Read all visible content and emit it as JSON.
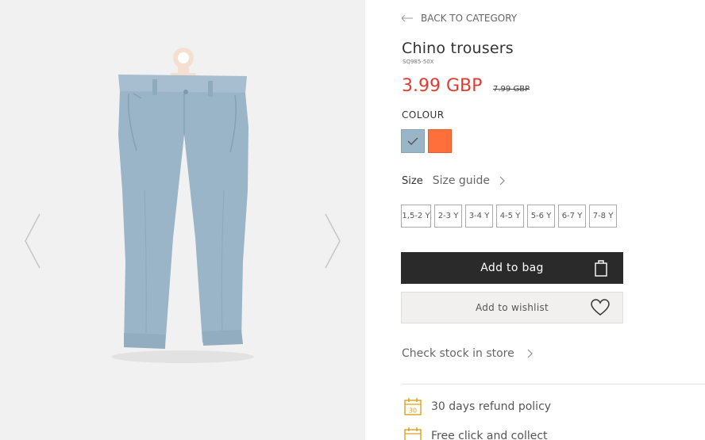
{
  "gallery": {
    "prev_icon": "chevron-left-icon",
    "next_icon": "chevron-right-icon",
    "product_colors": {
      "fabric": "#9ab4c8",
      "hanger": "#f5dfd0",
      "background": "#f1f1f1"
    }
  },
  "product": {
    "back_label": "BACK TO CATEGORY",
    "title": "Chino trousers",
    "sku": "SQ985-50X",
    "price": "3.99 GBP",
    "old_price": "7.99 GBP",
    "price_color": "#e03c31",
    "colour_label": "COLOUR",
    "colours": [
      {
        "name": "blue",
        "hex": "#9ab4c8",
        "selected": true
      },
      {
        "name": "orange",
        "hex": "#ff6f3c",
        "selected": false
      }
    ],
    "size_label": "Size",
    "size_guide_label": "Size guide",
    "sizes": [
      "1,5-2 Y",
      "2-3 Y",
      "3-4 Y",
      "4-5 Y",
      "5-6 Y",
      "6-7 Y",
      "7-8 Y"
    ],
    "add_to_bag_label": "Add to bag",
    "add_to_wishlist_label": "Add to wishlist",
    "check_stock_label": "Check stock in store",
    "features": [
      {
        "icon": "calendar-30-icon",
        "label": "30 days refund policy"
      },
      {
        "icon": "calendar-icon",
        "label": "Free click and collect"
      }
    ]
  }
}
